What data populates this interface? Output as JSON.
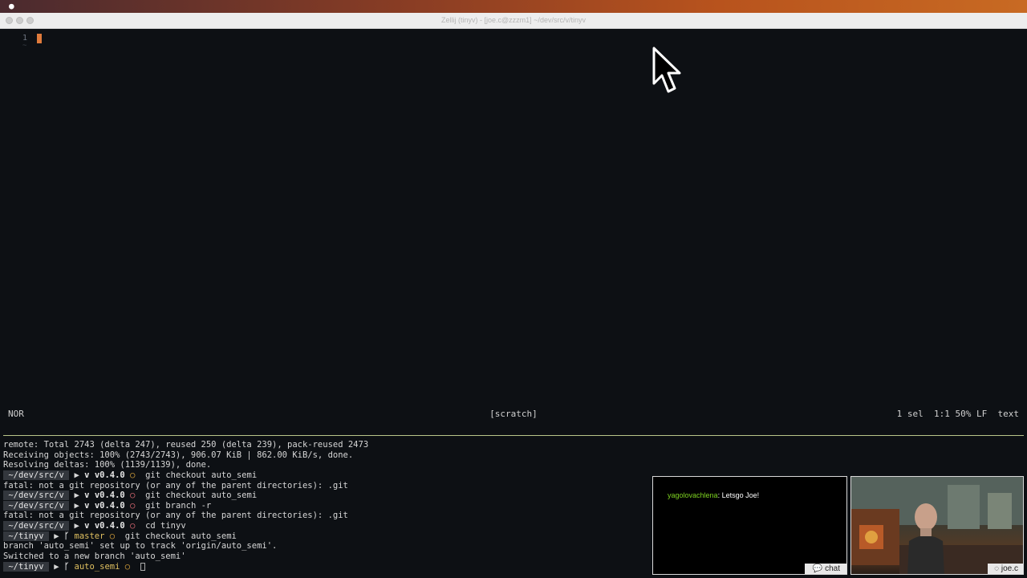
{
  "window": {
    "title": "Zellij (tinyv) - [joe.c@zzzm1] ~/dev/src/v/tinyv"
  },
  "editor": {
    "line_number": "1",
    "tilde": "~"
  },
  "statusline": {
    "mode": "NOR",
    "buffer": "[scratch]",
    "selection": "1 sel",
    "position": "1:1",
    "percent": "50%",
    "line_ending": "LF",
    "language": "text"
  },
  "terminal": {
    "lines": [
      {
        "type": "text",
        "text": "remote: Total 2743 (delta 247), reused 250 (delta 239), pack-reused 2473"
      },
      {
        "type": "text",
        "text": "Receiving objects: 100% (2743/2743), 906.07 KiB | 862.00 KiB/s, done."
      },
      {
        "type": "text",
        "text": "Resolving deltas: 100% (1139/1139), done."
      },
      {
        "type": "prompt",
        "dir": " ~/dev/src/v ",
        "sep": " ▶ ",
        "vcs_icon": "v",
        "version": "v0.4.0",
        "status": "○",
        "status_kind": "ok",
        "cmd": "git checkout auto_semi"
      },
      {
        "type": "text",
        "text": "fatal: not a git repository (or any of the parent directories): .git"
      },
      {
        "type": "prompt",
        "dir": " ~/dev/src/v ",
        "sep": " ▶ ",
        "vcs_icon": "v",
        "version": "v0.4.0",
        "status": "○",
        "status_kind": "err",
        "cmd": "git checkout auto_semi"
      },
      {
        "type": "prompt",
        "dir": " ~/dev/src/v ",
        "sep": " ▶ ",
        "vcs_icon": "v",
        "version": "v0.4.0",
        "status": "○",
        "status_kind": "err",
        "cmd": "git branch -r"
      },
      {
        "type": "text",
        "text": "fatal: not a git repository (or any of the parent directories): .git"
      },
      {
        "type": "prompt",
        "dir": " ~/dev/src/v ",
        "sep": " ▶ ",
        "vcs_icon": "v",
        "version": "v0.4.0",
        "status": "○",
        "status_kind": "err",
        "cmd": "cd tinyv"
      },
      {
        "type": "prompt",
        "dir": " ~/tinyv ",
        "sep": " ▶ ",
        "vcs_icon": "ᚴ",
        "version": "master",
        "status": "○",
        "status_kind": "ok",
        "cmd": "git checkout auto_semi"
      },
      {
        "type": "text",
        "text": "branch 'auto_semi' set up to track 'origin/auto_semi'."
      },
      {
        "type": "text",
        "text": "Switched to a new branch 'auto_semi'"
      },
      {
        "type": "prompt",
        "dir": " ~/tinyv ",
        "sep": " ▶ ",
        "vcs_icon": "ᚴ",
        "version": "auto_semi",
        "status": "○",
        "status_kind": "ok",
        "cmd": "",
        "cursor": true
      }
    ]
  },
  "chat": {
    "username": "yagolovachlena",
    "message": ": Letsgo Joe!",
    "tab_icon": "💬",
    "tab_label": "chat"
  },
  "webcam": {
    "tab_icon": "◌",
    "tab_label": "joe.c"
  },
  "colors": {
    "background": "#0d1014",
    "cursor": "#e07b3c",
    "divider": "#b9c58a",
    "chat_user": "#7ed321"
  }
}
